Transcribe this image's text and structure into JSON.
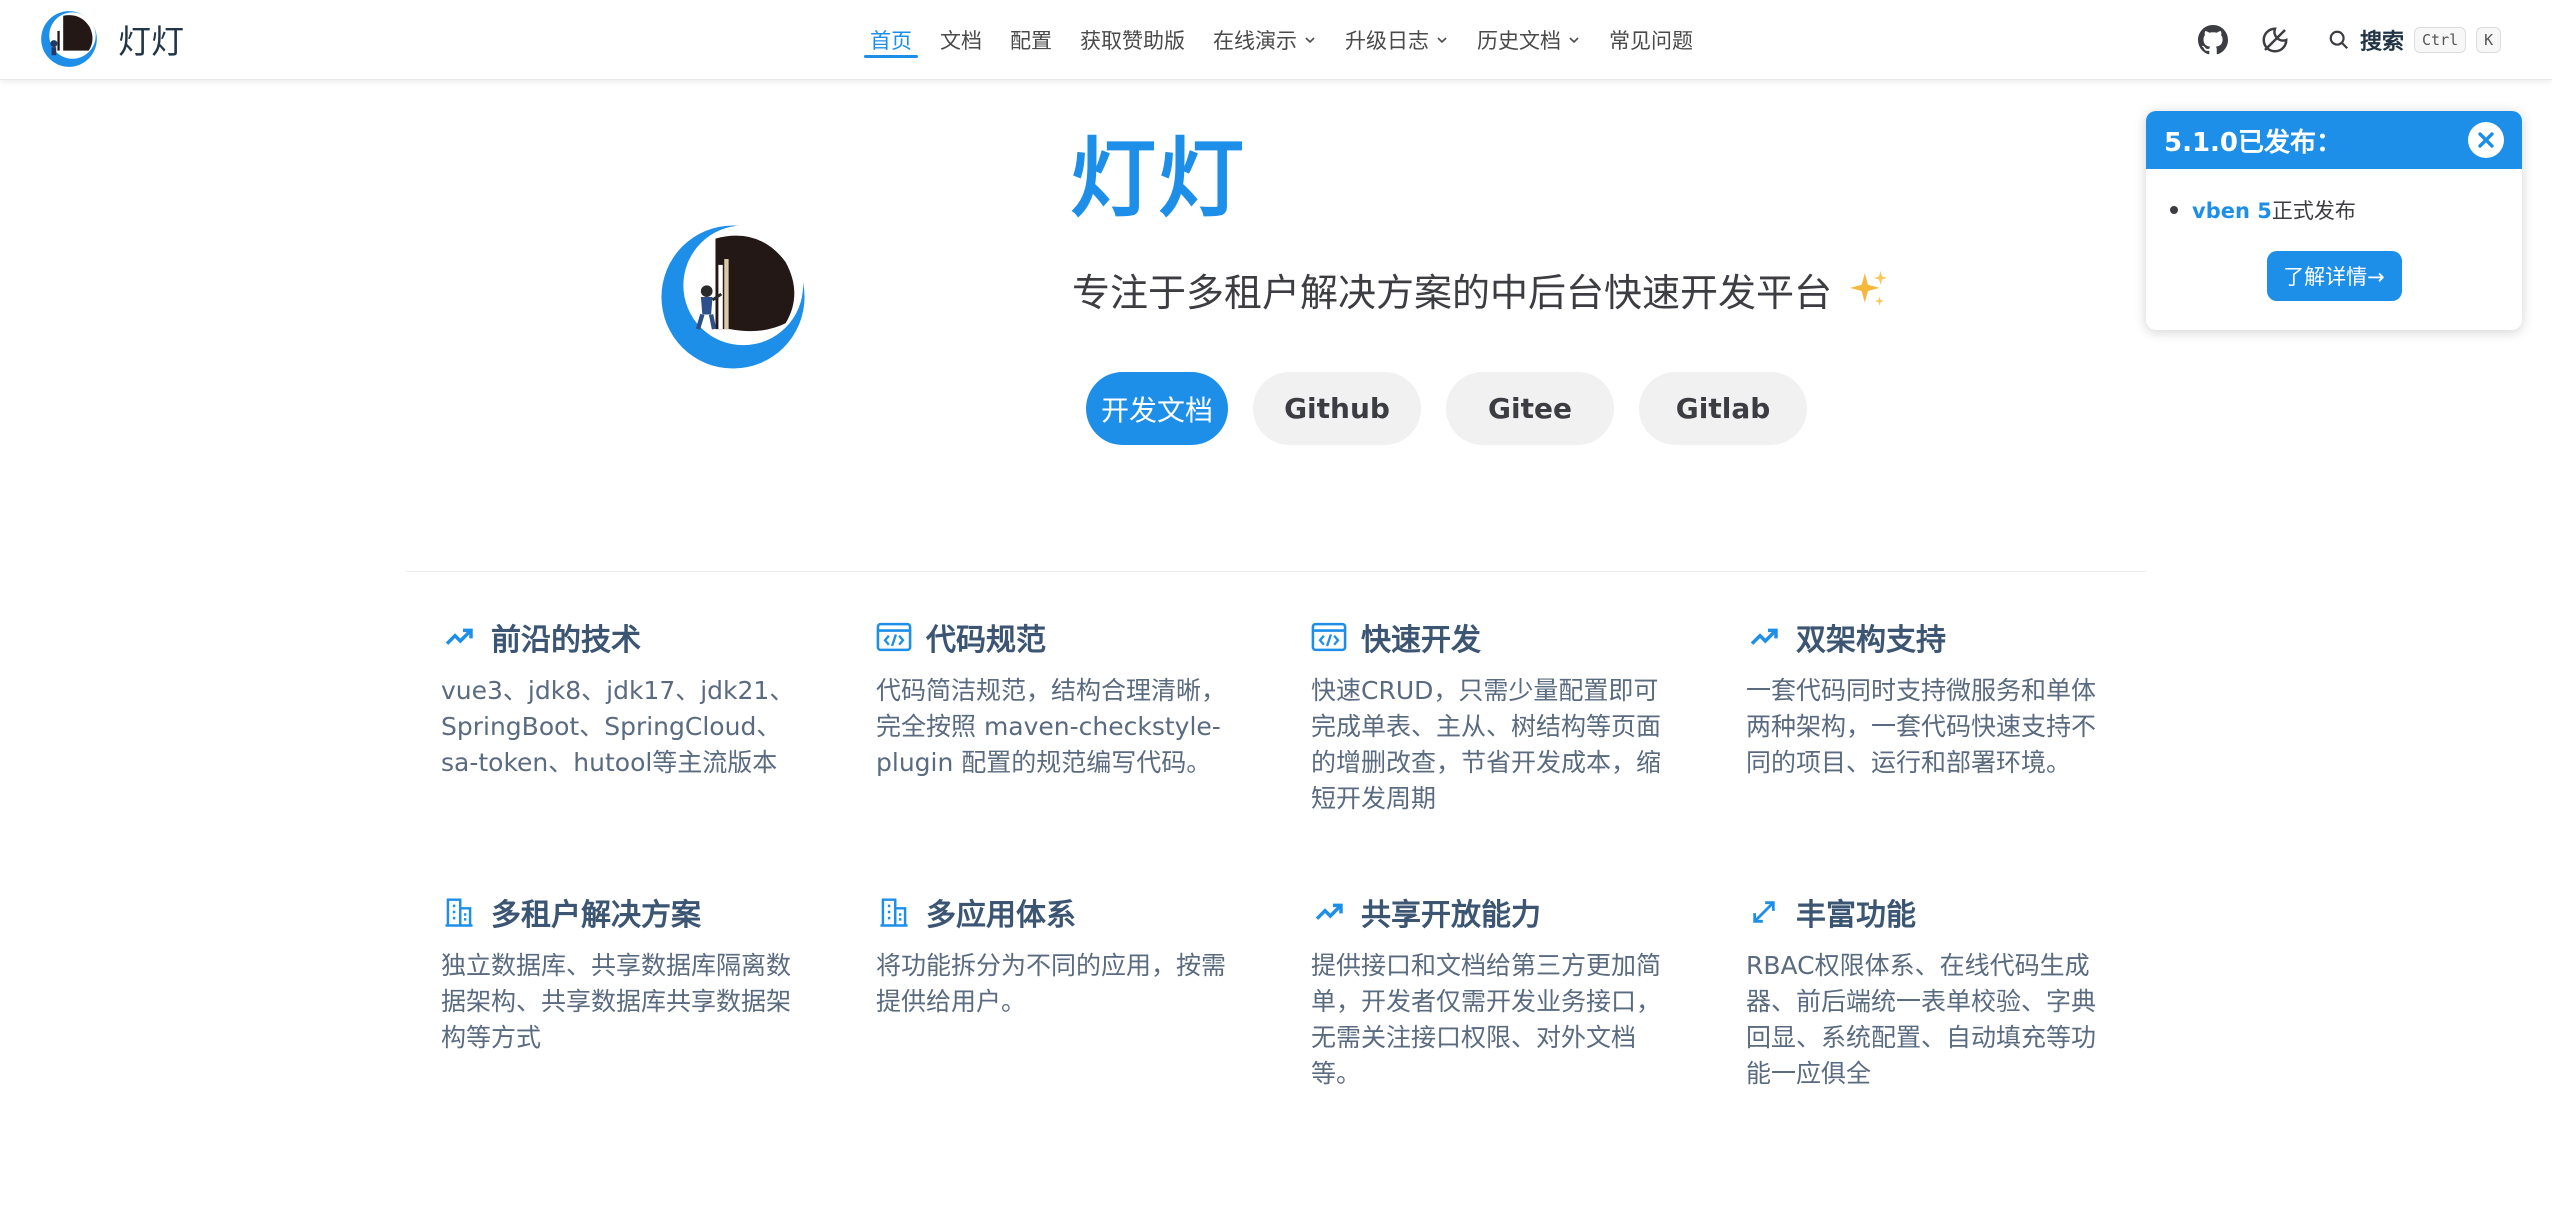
{
  "brand": {
    "title": "灯灯"
  },
  "nav": {
    "items": [
      {
        "label": "首页"
      },
      {
        "label": "文档"
      },
      {
        "label": "配置"
      },
      {
        "label": "获取赞助版"
      },
      {
        "label": "在线演示"
      },
      {
        "label": "升级日志"
      },
      {
        "label": "历史文档"
      },
      {
        "label": "常见问题"
      }
    ],
    "active": "首页",
    "search_label": "搜索",
    "kbd_ctrl": "Ctrl",
    "kbd_k": "K",
    "icons": [
      "github-icon",
      "theme-toggle-icon",
      "search-icon"
    ]
  },
  "hero": {
    "name": "灯灯",
    "tagline": "专注于多租户解决方案的中后台快速开发平台",
    "buttons": {
      "docs": "开发文档",
      "github": "Github",
      "gitee": "Gitee",
      "gitlab": "Gitlab"
    }
  },
  "features": [
    {
      "title": "前沿的技术",
      "icon": "trending-up-icon",
      "desc": "vue3、jdk8、jdk17、jdk21、SpringBoot、SpringCloud、sa-token、hutool等主流版本"
    },
    {
      "title": "代码规范",
      "icon": "code-window-icon",
      "desc": "代码简洁规范，结构合理清晰，完全按照 maven-checkstyle-plugin 配置的规范编写代码。"
    },
    {
      "title": "快速开发",
      "icon": "code-window-icon",
      "desc": "快速CRUD，只需少量配置即可完成单表、主从、树结构等页面的增删改查，节省开发成本，缩短开发周期"
    },
    {
      "title": "双架构支持",
      "icon": "trending-up-icon",
      "desc": "一套代码同时支持微服务和单体两种架构，一套代码快速支持不同的项目、运行和部署环境。"
    },
    {
      "title": "多租户解决方案",
      "icon": "building-icon",
      "desc": "独立数据库、共享数据库隔离数据架构、共享数据库共享数据架构等方式"
    },
    {
      "title": "多应用体系",
      "icon": "building-icon",
      "desc": "将功能拆分为不同的应用，按需提供给用户。"
    },
    {
      "title": "共享开放能力",
      "icon": "trending-up-icon",
      "desc": "提供接口和文档给第三方更加简单，开发者仅需开发业务接口，无需关注接口权限、对外文档等。"
    },
    {
      "title": "丰富功能",
      "icon": "expand-arrows-icon",
      "desc": "RBAC权限体系、在线代码生成器、前后端统一表单校验、字典回显、系统配置、自动填充等功能一应俱全"
    }
  ],
  "notice": {
    "title": "5.1.0已发布：",
    "link_text": "vben 5",
    "line_rest": "正式发布",
    "button": "了解详情→"
  },
  "colors": {
    "accent": "#1e8fe8",
    "feature_title": "#3b5573",
    "feature_text": "#5a6b80"
  }
}
